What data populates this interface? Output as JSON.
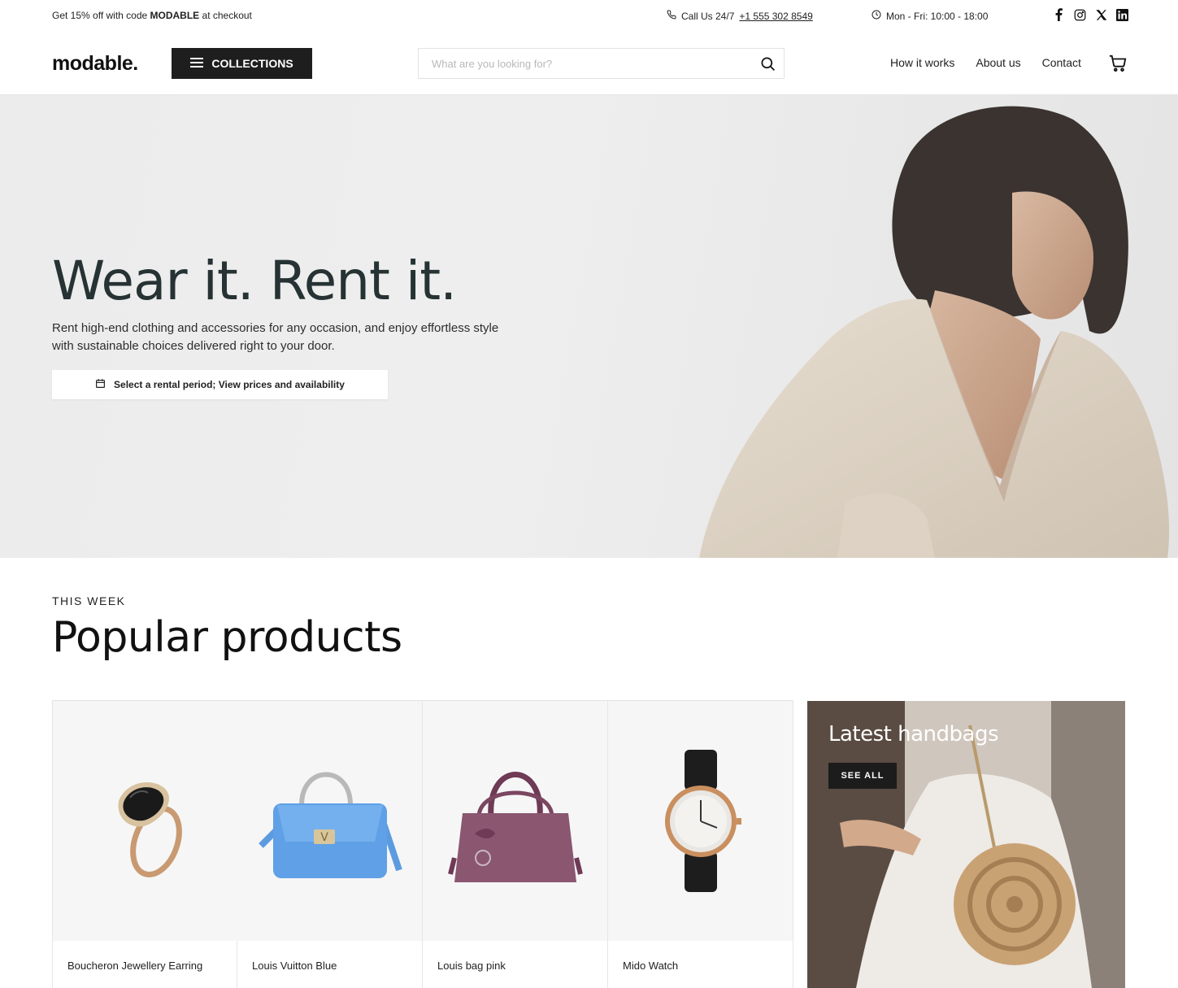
{
  "topbar": {
    "promo_prefix": "Get 15% off with code ",
    "promo_code": "MODABLE",
    "promo_suffix": " at checkout",
    "call_label": "Call Us 24/7",
    "phone": "+1 555 302 8549",
    "hours": "Mon - Fri: 10:00 - 18:00",
    "social_icons": [
      "facebook-icon",
      "instagram-icon",
      "x-icon",
      "linkedin-icon"
    ]
  },
  "header": {
    "logo": "modable.",
    "collections_label": "COLLECTIONS",
    "search_placeholder": "What are you looking for?",
    "nav": [
      "How it works",
      "About us",
      "Contact"
    ]
  },
  "hero": {
    "title": "Wear it. Rent it.",
    "subtitle": "Rent high-end clothing and accessories for any occasion, and enjoy effortless style with sustainable choices delivered right to your door.",
    "cta": "Select a rental period; View prices and availability"
  },
  "popular": {
    "eyebrow": "THIS WEEK",
    "title": "Popular products",
    "products": [
      {
        "name": "Boucheron Jewellery Earring"
      },
      {
        "name": "Louis Vuitton Blue"
      },
      {
        "name": "Louis bag pink"
      },
      {
        "name": "Mido Watch"
      }
    ],
    "promo_tile": {
      "title": "Latest handbags",
      "button": "SEE ALL"
    }
  },
  "colors": {
    "brand_dark": "#1e1e1e",
    "hero_bg": "#ececec",
    "card_bg": "#f6f6f6"
  }
}
